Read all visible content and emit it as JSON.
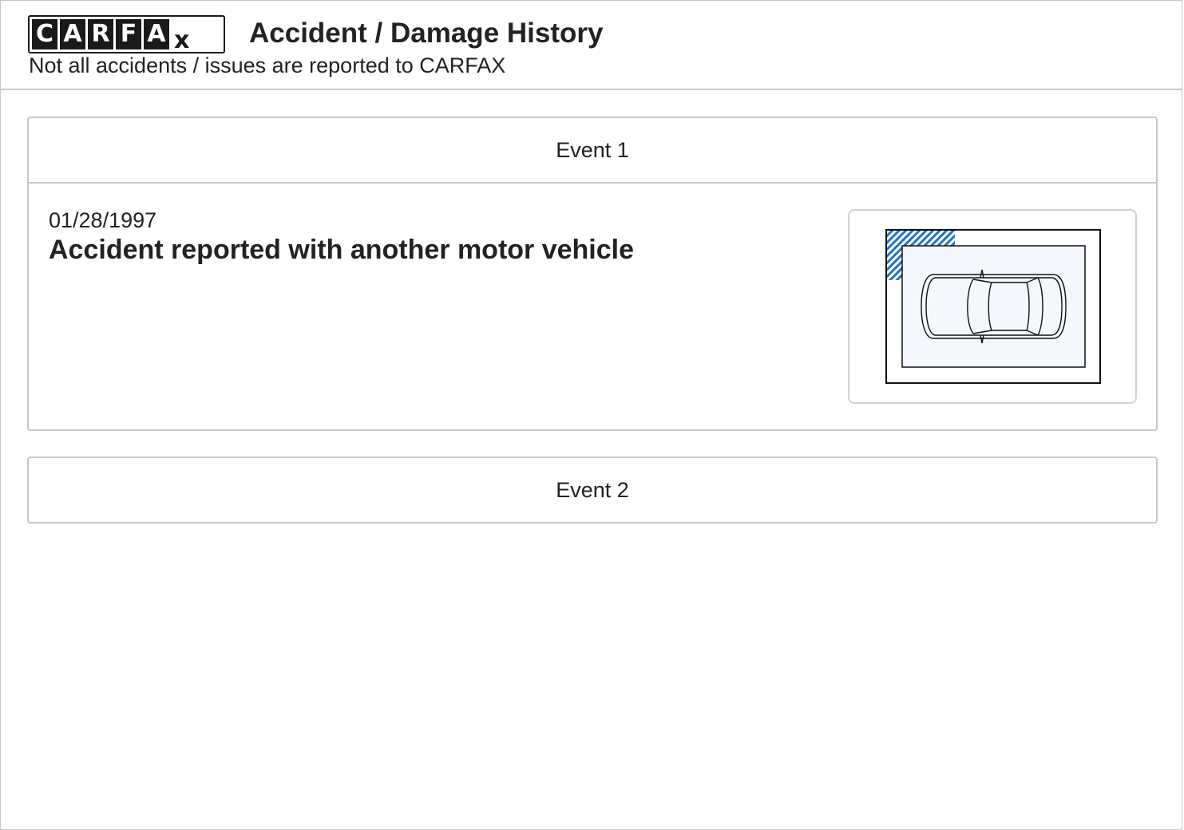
{
  "logo": {
    "letters": [
      "C",
      "A",
      "R",
      "F",
      "A"
    ],
    "tail": "x",
    "alt": "CARFAX"
  },
  "header": {
    "title": "Accident / Damage History",
    "subtitle": "Not all accidents / issues are reported to CARFAX"
  },
  "events": [
    {
      "label": "Event 1",
      "expanded": true,
      "date": "01/28/1997",
      "description": "Accident reported with another motor vehicle",
      "damage_area": "front-left"
    },
    {
      "label": "Event 2",
      "expanded": false
    }
  ],
  "colors": {
    "damage_hatch": "#1e73c8",
    "border": "#c8c8c8",
    "text": "#222222"
  },
  "icons": {
    "vehicle_diagram": "car-top-view-icon"
  }
}
